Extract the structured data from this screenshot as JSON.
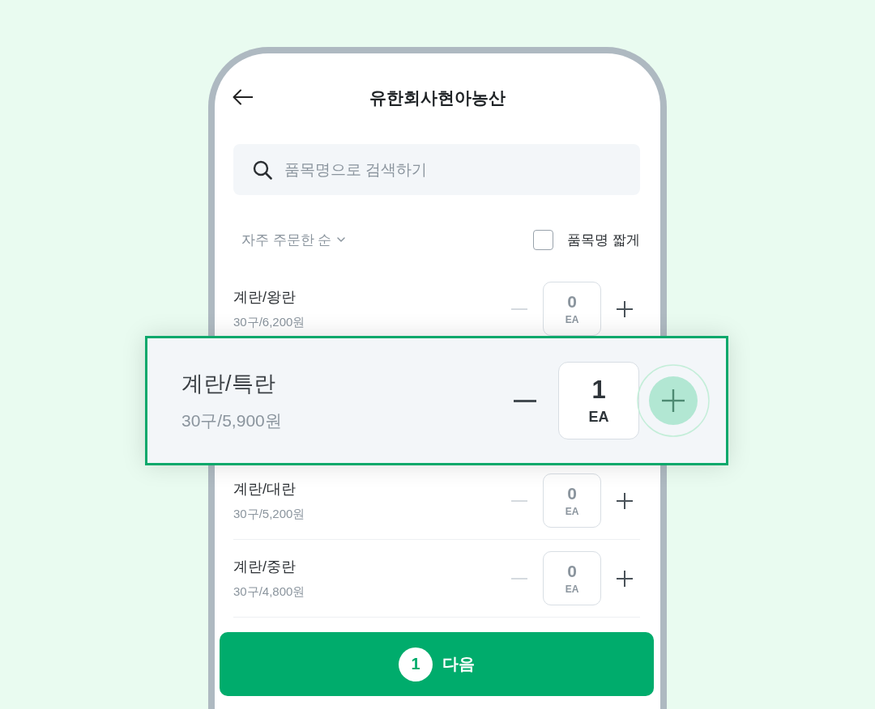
{
  "header": {
    "title": "유한회사현아농산"
  },
  "search": {
    "placeholder": "품목명으로 검색하기"
  },
  "sort": {
    "label": "자주 주문한 순"
  },
  "short_names": {
    "label": "품목명 짧게",
    "checked": false
  },
  "items": [
    {
      "name": "계란/왕란",
      "price": "30구/6,200원",
      "quantity": "0",
      "unit": "EA",
      "decrease_disabled": true,
      "highlighted": false,
      "plus_pressed": false
    },
    {
      "name": "계란/특란",
      "price": "30구/5,900원",
      "quantity": "1",
      "unit": "EA",
      "decrease_disabled": false,
      "highlighted": true,
      "plus_pressed": true
    },
    {
      "name": "계란/대란",
      "price": "30구/5,200원",
      "quantity": "0",
      "unit": "EA",
      "decrease_disabled": true,
      "highlighted": false,
      "plus_pressed": false
    },
    {
      "name": "계란/중란",
      "price": "30구/4,800원",
      "quantity": "0",
      "unit": "EA",
      "decrease_disabled": true,
      "highlighted": false,
      "plus_pressed": false
    }
  ],
  "next_button": {
    "count": "1",
    "label": "다음"
  }
}
